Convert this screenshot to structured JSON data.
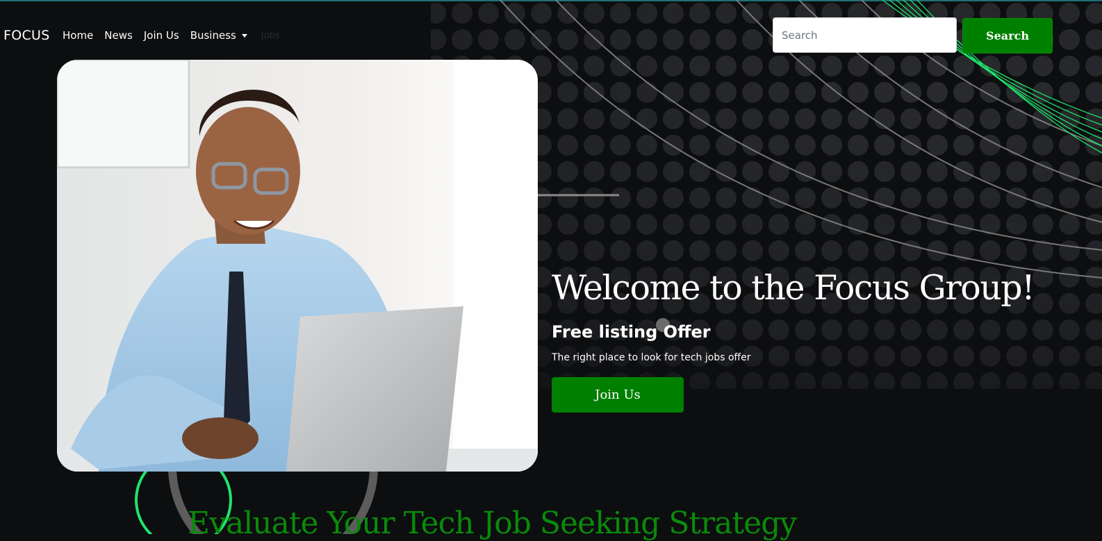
{
  "navbar": {
    "brand": "FOCUS",
    "links": [
      "Home",
      "News",
      "Join Us",
      "Business"
    ],
    "faint_text": "Jobs"
  },
  "search": {
    "placeholder": "Search",
    "value": "",
    "button_label": "Search"
  },
  "hero": {
    "title": "Welcome to the Focus Group!",
    "subtitle": "Free listing Offer",
    "tagline": "The right place to look for tech jobs offer",
    "cta_label": "Join Us",
    "photo": "man-with-laptop-photo"
  },
  "next_section": {
    "heading": "Evaluate Your Tech Job Seeking Strategy"
  },
  "colors": {
    "background": "#0d0e10",
    "accent_green": "#008000",
    "heading_green": "#0a8a0a",
    "neon_green": "#1fe36b",
    "text": "#ffffff"
  }
}
